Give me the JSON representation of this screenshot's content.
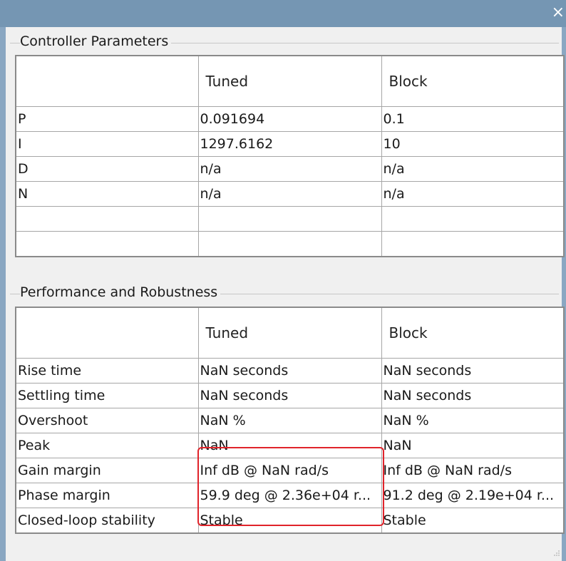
{
  "window": {
    "close_glyph": "×"
  },
  "controller_parameters": {
    "title": "Controller Parameters",
    "columns": [
      "",
      "Tuned",
      "Block"
    ],
    "rows": [
      {
        "label": "P",
        "tuned": "0.091694",
        "block": "0.1"
      },
      {
        "label": "I",
        "tuned": "1297.6162",
        "block": "10"
      },
      {
        "label": "D",
        "tuned": "n/a",
        "block": "n/a"
      },
      {
        "label": "N",
        "tuned": "n/a",
        "block": "n/a"
      },
      {
        "label": "",
        "tuned": "",
        "block": ""
      },
      {
        "label": "",
        "tuned": "",
        "block": ""
      }
    ]
  },
  "performance_robustness": {
    "title": "Performance and Robustness",
    "columns": [
      "",
      "Tuned",
      "Block"
    ],
    "rows": [
      {
        "label": "Rise time",
        "tuned": "NaN seconds",
        "block": "NaN seconds"
      },
      {
        "label": "Settling time",
        "tuned": "NaN seconds",
        "block": "NaN seconds"
      },
      {
        "label": "Overshoot",
        "tuned": "NaN %",
        "block": "NaN %"
      },
      {
        "label": "Peak",
        "tuned": "NaN",
        "block": "NaN"
      },
      {
        "label": "Gain margin",
        "tuned": "Inf dB @ NaN rad/s",
        "block": "Inf dB @ NaN rad/s"
      },
      {
        "label": "Phase margin",
        "tuned": "59.9 deg @ 2.36e+04 r...",
        "block": "91.2 deg @ 2.19e+04 r..."
      },
      {
        "label": "Closed-loop stability",
        "tuned": "Stable",
        "block": "Stable"
      }
    ]
  },
  "colors": {
    "titlebar": "#7596b3",
    "highlight": "#e0232a"
  }
}
